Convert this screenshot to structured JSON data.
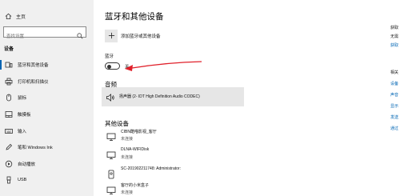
{
  "sidebar": {
    "home_label": "主页",
    "search_placeholder": "查找设置",
    "section_title": "设备",
    "items": [
      {
        "label": "蓝牙和其他设备",
        "icon": "bluetooth-devices-icon",
        "active": true
      },
      {
        "label": "打印机和扫描仪",
        "icon": "printer-icon",
        "active": false
      },
      {
        "label": "鼠标",
        "icon": "mouse-icon",
        "active": false
      },
      {
        "label": "触摸板",
        "icon": "touchpad-icon",
        "active": false
      },
      {
        "label": "输入",
        "icon": "keyboard-icon",
        "active": false
      },
      {
        "label": "笔和 Windows Ink",
        "icon": "pen-icon",
        "active": false
      },
      {
        "label": "自动播放",
        "icon": "autoplay-icon",
        "active": false
      },
      {
        "label": "USB",
        "icon": "usb-icon",
        "active": false
      }
    ]
  },
  "main": {
    "title": "蓝牙和其他设备",
    "add_device_label": "添加蓝牙或其他设备",
    "bluetooth_label": "蓝牙",
    "bluetooth_state": "关",
    "audio_heading": "音频",
    "audio_device": "扬声器 (2- IDT High Definition Audio CODEC)",
    "other_heading": "其他设备",
    "other_devices": [
      {
        "name": "CIBN酷喵影视_客厅",
        "status": "未连接"
      },
      {
        "name": "DLNA-WIFIDisk",
        "status": "未连接"
      },
      {
        "name": "SC-201902211748: Administrator:",
        "status": ""
      },
      {
        "name": "客厅的小米盒子",
        "status": "未连接"
      }
    ]
  },
  "right_panel": {
    "heading1": "获取",
    "lines1": [
      "无需",
      "获取"
    ],
    "heading2": "相关",
    "links": [
      "设备",
      "声音",
      "显示",
      "发送",
      "通过"
    ]
  },
  "colors": {
    "accent": "#0063b1",
    "link": "#0066b4",
    "arrow": "#e0202a"
  }
}
